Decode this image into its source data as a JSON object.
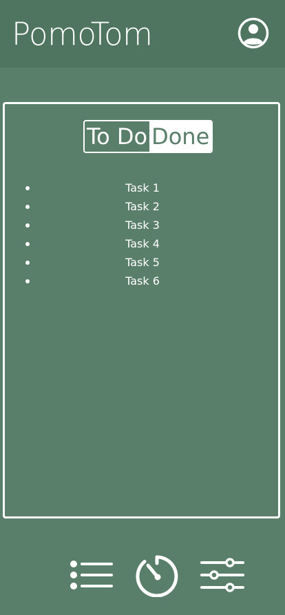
{
  "header": {
    "title": "PomoTom",
    "profile_icon": "account-circle-icon"
  },
  "tabs": {
    "todo_label": "To Do",
    "done_label": "Done",
    "selected": "Done"
  },
  "tasks": [
    {
      "label": "Task 1"
    },
    {
      "label": "Task 2"
    },
    {
      "label": "Task 3"
    },
    {
      "label": "Task 4"
    },
    {
      "label": "Task 5"
    },
    {
      "label": "Task 6"
    }
  ],
  "bottom_nav": {
    "items": [
      "list-icon",
      "timer-icon",
      "sliders-icon"
    ]
  },
  "colors": {
    "background": "#597e69",
    "header": "#4f7560",
    "foreground": "#ffffff"
  }
}
